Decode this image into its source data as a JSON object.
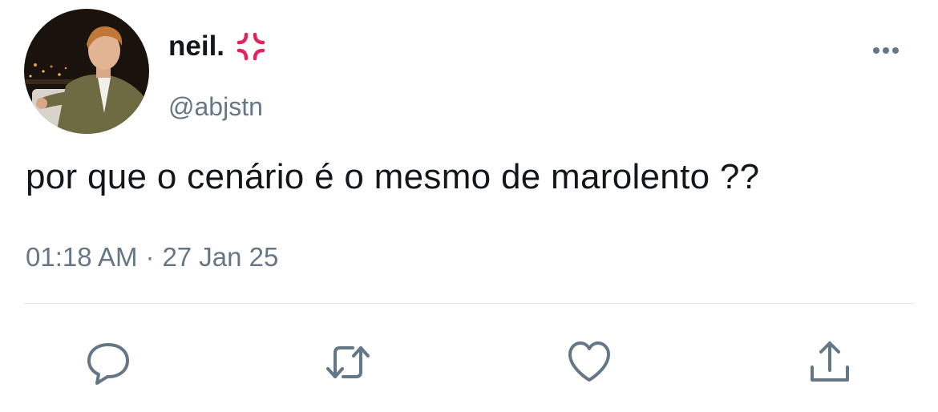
{
  "tweet": {
    "author": {
      "display_name": "neil.",
      "handle": "@abjstn",
      "avatar_icon": "user-photo",
      "badge_icon": "anger-symbol-icon"
    },
    "text": "por que o cenário é o mesmo de marolento ??",
    "time": "01:18 AM",
    "separator": "·",
    "date": "27 Jan 25"
  },
  "actions": [
    {
      "name": "reply",
      "icon": "comment-icon"
    },
    {
      "name": "retweet",
      "icon": "retweet-icon"
    },
    {
      "name": "like",
      "icon": "heart-icon"
    },
    {
      "name": "share",
      "icon": "share-icon"
    }
  ],
  "colors": {
    "text_primary": "#14171a",
    "text_secondary": "#657786",
    "icon": "#657786",
    "divider": "#e1e8ed",
    "anger_red": "#e0245e"
  }
}
